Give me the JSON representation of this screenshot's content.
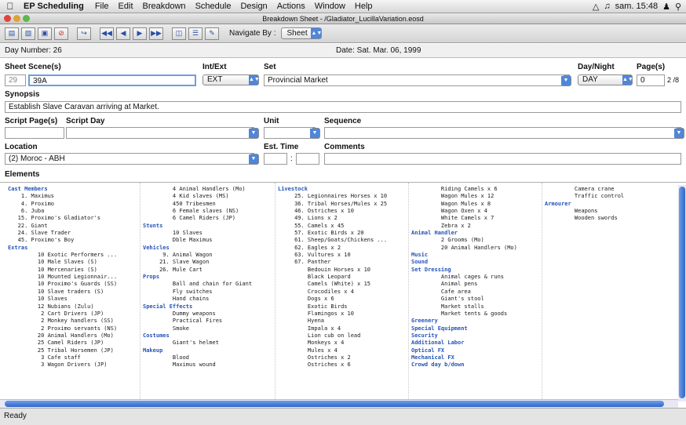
{
  "menubar": {
    "app": "EP Scheduling",
    "items": [
      "File",
      "Edit",
      "Breakdown",
      "Schedule",
      "Design",
      "Actions",
      "Window",
      "Help"
    ],
    "clock": "sam. 15:48"
  },
  "window": {
    "title": "Breakdown Sheet - /Gladiator_LucillaVariation.eosd"
  },
  "toolbar": {
    "navigate_label": "Navigate By :",
    "navigate_value": "Sheet"
  },
  "header": {
    "day_number": "Day Number: 26",
    "date": "Date: Sat. Mar. 06, 1999"
  },
  "fields": {
    "sheet_label": "Sheet",
    "sheet_value": "29",
    "scenes_label": "Scene(s)",
    "scenes_value": "39A",
    "intext_label": "Int/Ext",
    "intext_value": "EXT",
    "set_label": "Set",
    "set_value": "Provincial Market",
    "daynight_label": "Day/Night",
    "daynight_value": "DAY",
    "pages_label": "Page(s)",
    "pages_value": "0",
    "pages_frac": "2 /8",
    "synopsis_label": "Synopsis",
    "synopsis_value": "Establish Slave Caravan arriving at Market.",
    "script_pages_label": "Script Page(s)",
    "script_day_label": "Script Day",
    "unit_label": "Unit",
    "sequence_label": "Sequence",
    "location_label": "Location",
    "location_value": "(2) Moroc - ABH",
    "est_time_label": "Est. Time",
    "est_time_sep": ":",
    "comments_label": "Comments"
  },
  "elements": {
    "label": "Elements",
    "columns": [
      [
        {
          "h": "Cast Members"
        },
        {
          "i": "    1. Maximus"
        },
        {
          "i": "    4. Proximo"
        },
        {
          "i": "    6. Juba"
        },
        {
          "i": "   15. Proximo's Gladiator's"
        },
        {
          "i": "   22. Giant"
        },
        {
          "i": "   24. Slave Trader"
        },
        {
          "i": "   45. Proximo's Boy"
        },
        {
          "h": "Extras"
        },
        {
          "i": "         10 Exotic Performers ..."
        },
        {
          "i": "         10 Male Slaves (S)"
        },
        {
          "i": "         10 Mercenaries (S)"
        },
        {
          "i": "         10 Mounted Legionnair..."
        },
        {
          "i": "         10 Proximo's Guards (SS)"
        },
        {
          "i": "         10 Slave traders (S)"
        },
        {
          "i": "         10 Slaves"
        },
        {
          "i": "         12 Nubians (Zulu)"
        },
        {
          "i": "          2 Cart Drivers (JP)"
        },
        {
          "i": "          2 Monkey handlers (SS)"
        },
        {
          "i": "          2 Proximo servants (NS)"
        },
        {
          "i": "         20 Animal Handlers (Mo)"
        },
        {
          "i": "         25 Camel Riders (JP)"
        },
        {
          "i": "         25 Tribal Horsemen (JP)"
        },
        {
          "i": "          3 Cafe staff"
        },
        {
          "i": "          3 Wagon Drivers (JP)"
        }
      ],
      [
        {
          "i": "         4 Animal Handlers (Mo)"
        },
        {
          "i": "         4 Kid slaves (MS)"
        },
        {
          "i": "         450 Tribesmen"
        },
        {
          "i": "         6 Female slaves (NS)"
        },
        {
          "i": "         6 Camel Riders (JP)"
        },
        {
          "h": "Stunts"
        },
        {
          "i": "         10 Slaves"
        },
        {
          "i": "         Dble Maximus"
        },
        {
          "h": "Vehicles"
        },
        {
          "i": "      9. Animal Wagon"
        },
        {
          "i": "     21. Slave Wagon"
        },
        {
          "i": "     26. Mule Cart"
        },
        {
          "h": "Props"
        },
        {
          "i": "         Ball and chain for Giant"
        },
        {
          "i": "         Fly switches"
        },
        {
          "i": "         Hand chains"
        },
        {
          "h": "Special Effects"
        },
        {
          "i": "         Dummy weapons"
        },
        {
          "i": "         Practical Fires"
        },
        {
          "i": "         Smoke"
        },
        {
          "h": "Costumes"
        },
        {
          "i": "         Giant's helmet"
        },
        {
          "h": "Makeup"
        },
        {
          "i": "         Blood"
        },
        {
          "i": "         Maximus wound"
        }
      ],
      [
        {
          "h": "Livestock"
        },
        {
          "i": "     25. Legionnaires Horses x 10"
        },
        {
          "i": "     36. Tribal Horses/Mules x 25"
        },
        {
          "i": "     46. Ostriches x 10"
        },
        {
          "i": "     49. Lions x 2"
        },
        {
          "i": "     55. Camels x 45"
        },
        {
          "i": "     57. Exotic Birds x 20"
        },
        {
          "i": "     61. Sheep/Goats/Chickens ..."
        },
        {
          "i": "     62. Eagles x 2"
        },
        {
          "i": "     63. Vultures x 10"
        },
        {
          "i": "     67. Panther"
        },
        {
          "i": "         Bedouin Horses x 10"
        },
        {
          "i": "         Black Leopard"
        },
        {
          "i": "         Camels (White) x 15"
        },
        {
          "i": "         Crocodiles x 4"
        },
        {
          "i": "         Dogs x 6"
        },
        {
          "i": "         Exotic Birds"
        },
        {
          "i": "         Flamingos x 10"
        },
        {
          "i": "         Hyena"
        },
        {
          "i": "         Impala x 4"
        },
        {
          "i": "         Lion cub on lead"
        },
        {
          "i": "         Monkeys x 4"
        },
        {
          "i": "         Mules x 4"
        },
        {
          "i": "         Ostriches x 2"
        },
        {
          "i": "         Ostriches x 6"
        }
      ],
      [
        {
          "i": "         Riding Camels x 6"
        },
        {
          "i": "         Wagon Mules x 12"
        },
        {
          "i": "         Wagon Mules x 8"
        },
        {
          "i": "         Wagon Oxen x 4"
        },
        {
          "i": "         White Camels x 7"
        },
        {
          "i": "         Zebra x 2"
        },
        {
          "h": "Animal Handler"
        },
        {
          "i": "         2 Grooms (Mo)"
        },
        {
          "i": "         20 Animal Handlers (Mo)"
        },
        {
          "h": "Music"
        },
        {
          "h": "Sound"
        },
        {
          "h": "Set Dressing"
        },
        {
          "i": "         Animal cages & runs"
        },
        {
          "i": "         Animal pens"
        },
        {
          "i": "         Cafe area"
        },
        {
          "i": "         Giant's stool"
        },
        {
          "i": "         Market stalls"
        },
        {
          "i": "         Market tents & goods"
        },
        {
          "h": "Greenery"
        },
        {
          "h": "Special Equipment"
        },
        {
          "h": "Security"
        },
        {
          "h": "Additional Labor"
        },
        {
          "h": "Optical FX"
        },
        {
          "h": "Mechanical FX"
        },
        {
          "h": "Crowd day b/down"
        }
      ],
      [
        {
          "i": "         Camera crane"
        },
        {
          "i": "         Traffic control"
        },
        {
          "h": "Armourer"
        },
        {
          "i": "         Weapons"
        },
        {
          "i": "         Wooden swords"
        }
      ]
    ]
  },
  "status": "Ready"
}
